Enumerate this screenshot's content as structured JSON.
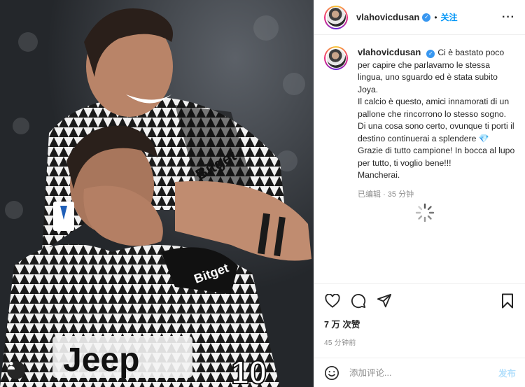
{
  "post": {
    "username": "vlahovicdusan",
    "verified_icon": "verified-badge-icon",
    "dot": "•",
    "follow_label": "关注",
    "more_icon": "more-options-icon",
    "more_glyph": "···",
    "caption": {
      "username": "vlahovicdusan",
      "text": "Ci è bastato poco per capire che parlavamo le stessa lingua, uno sguardo ed è stata subito Joya.\nIl calcio è questo, amici innamorati di un pallone che rincorrono lo stesso sogno.\nDi una cosa sono certo, ovunque ti porti il destino continuerai a splendere ",
      "emoji": "💎",
      "text_end": "\nGrazie di tutto campione! In bocca al lupo per tutto, ti voglio bene!!!\nMancherai.",
      "edited_label": "已编辑",
      "separator": "·",
      "relative_time": "35 分钟"
    },
    "likes": "7 万 次赞",
    "posted_time": "45 分钟前",
    "comment": {
      "placeholder": "添加评论...",
      "post_label": "发布"
    },
    "photo": {
      "jersey_text_1": "Jeep",
      "jersey_text_2": "Bitget",
      "jersey_text_3": "Bitget",
      "number": "10"
    },
    "colors": {
      "link_blue": "#0095f6",
      "post_disabled": "#b2dffc",
      "secondary_text": "#8e8e8e"
    }
  }
}
